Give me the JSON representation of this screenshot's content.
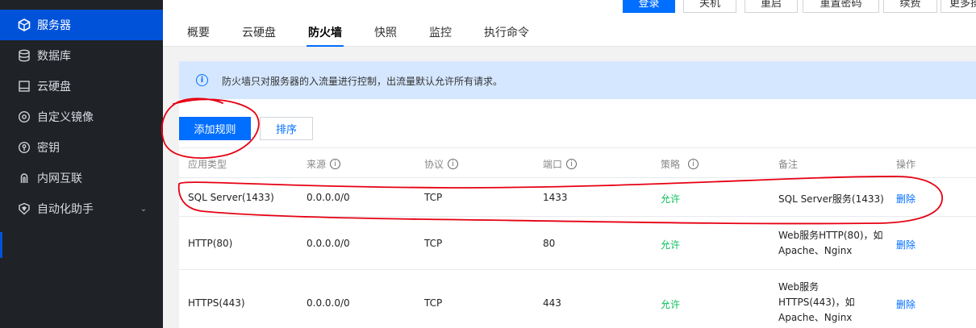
{
  "sidebar": {
    "items": [
      {
        "label": "服务器",
        "icon": "cube-icon",
        "active": true
      },
      {
        "label": "数据库",
        "icon": "database-icon"
      },
      {
        "label": "云硬盘",
        "icon": "disk-icon"
      },
      {
        "label": "自定义镜像",
        "icon": "disc-icon"
      },
      {
        "label": "密钥",
        "icon": "key-icon"
      },
      {
        "label": "内网互联",
        "icon": "link-icon"
      },
      {
        "label": "自动化助手",
        "icon": "assistant-icon",
        "expandable": true
      }
    ]
  },
  "toolbar": {
    "buttons": [
      "登录",
      "关机",
      "重启",
      "重置密码",
      "续费",
      "更多操作"
    ]
  },
  "tabs": [
    "概要",
    "云硬盘",
    "防火墙",
    "快照",
    "监控",
    "执行命令"
  ],
  "active_tab": "防火墙",
  "notice": {
    "icon": "info-icon",
    "text": "防火墙只对服务器的入流量进行控制，出流量默认允许所有请求。"
  },
  "actions": {
    "add_rule": "添加规则",
    "sort": "排序"
  },
  "table": {
    "headers": [
      "应用类型",
      "来源",
      "协议",
      "端口",
      "策略",
      "备注",
      "操作"
    ],
    "rows": [
      {
        "type": "SQL Server(1433)",
        "source": "0.0.0.0/0",
        "protocol": "TCP",
        "port": "1433",
        "policy": "允许",
        "note": "SQL Server服务(1433)",
        "action": "删除"
      },
      {
        "type": "HTTP(80)",
        "source": "0.0.0.0/0",
        "protocol": "TCP",
        "port": "80",
        "policy": "允许",
        "note_lines": [
          "Web服务HTTP(80)，如",
          "Apache、Nginx"
        ],
        "action": "删除"
      },
      {
        "type": "HTTPS(443)",
        "source": "0.0.0.0/0",
        "protocol": "TCP",
        "port": "443",
        "policy": "允许",
        "note_lines": [
          "Web服务",
          "HTTPS(443)，如",
          "Apache、Nginx"
        ],
        "action": "删除"
      }
    ]
  },
  "colors": {
    "sidebar_bg": "#1f2227",
    "active_blue": "#0052d9",
    "primary": "#006eff",
    "allow_green": "#0abf5b",
    "notice_bg": "#d5e7ff",
    "annotation_red": "#e60012"
  }
}
